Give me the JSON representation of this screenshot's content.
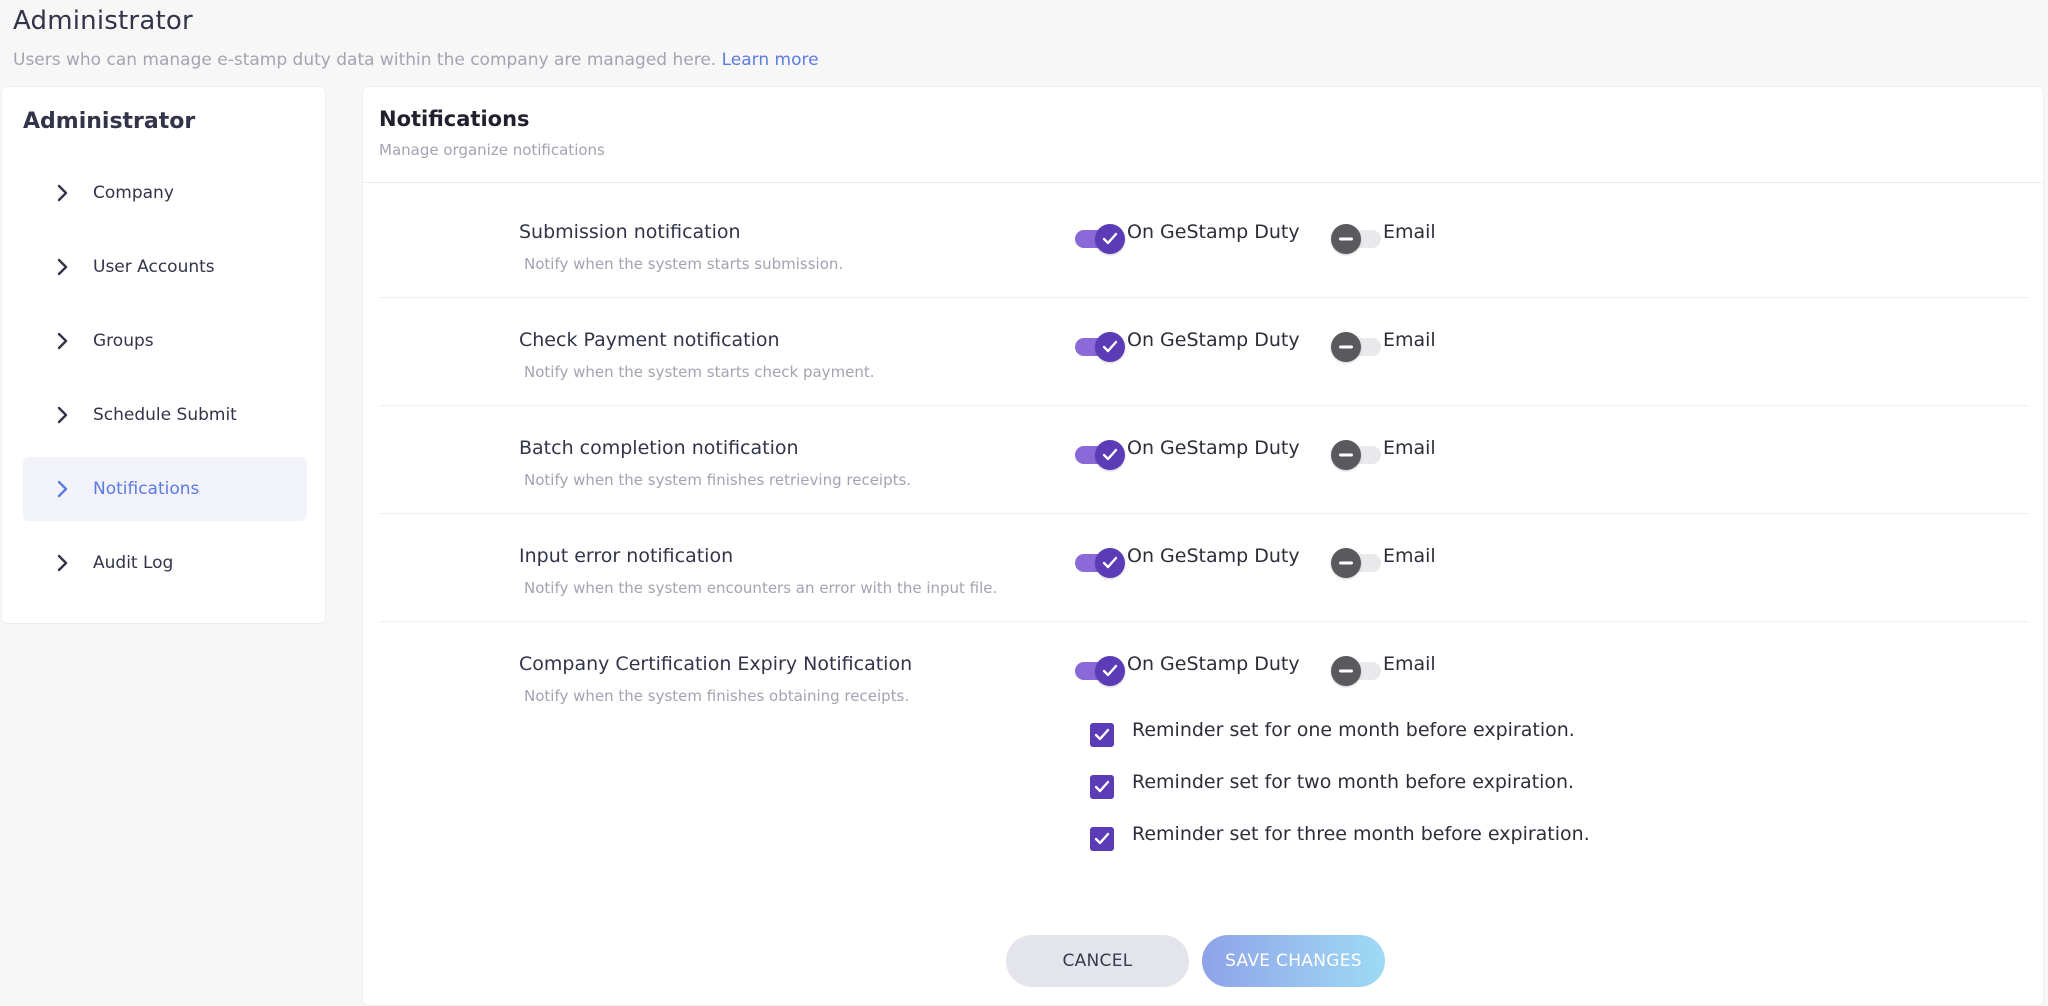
{
  "header": {
    "title": "Administrator",
    "subtitle": "Users who can manage e-stamp duty data within the company are managed here.",
    "learn_more": "Learn more"
  },
  "sidebar": {
    "title": "Administrator",
    "items": [
      {
        "label": "Company",
        "icon": "chevron-right-icon",
        "active": false
      },
      {
        "label": "User Accounts",
        "icon": "chevron-right-icon",
        "active": false
      },
      {
        "label": "Groups",
        "icon": "chevron-right-icon",
        "active": false
      },
      {
        "label": "Schedule Submit",
        "icon": "chevron-right-icon",
        "active": false
      },
      {
        "label": "Notifications",
        "icon": "chevron-right-icon",
        "active": true
      },
      {
        "label": "Audit Log",
        "icon": "chevron-right-icon",
        "active": false
      }
    ]
  },
  "main": {
    "title": "Notifications",
    "subtitle": "Manage organize notifications",
    "toggle_labels": {
      "system": "On GeStamp Duty",
      "email": "Email"
    },
    "notifications": [
      {
        "title": "Submission notification",
        "description": "Notify when the system starts submission.",
        "system_on": true,
        "email_on": false
      },
      {
        "title": "Check Payment notification",
        "description": "Notify when the system starts check payment.",
        "system_on": true,
        "email_on": false
      },
      {
        "title": "Batch completion notification",
        "description": "Notify when the system finishes retrieving receipts.",
        "system_on": true,
        "email_on": false
      },
      {
        "title": "Input error notification",
        "description": "Notify when the system encounters an error with the input file.",
        "system_on": true,
        "email_on": false
      },
      {
        "title": "Company Certification Expiry Notification",
        "description": "Notify when the system finishes obtaining receipts.",
        "system_on": true,
        "email_on": false
      }
    ],
    "reminders": [
      {
        "label": "Reminder set for one month before expiration.",
        "checked": true
      },
      {
        "label": "Reminder set for two month before expiration.",
        "checked": true
      },
      {
        "label": "Reminder set for three month before expiration.",
        "checked": true
      }
    ],
    "buttons": {
      "cancel": "CANCEL",
      "save": "SAVE CHANGES"
    }
  },
  "colors": {
    "accent": "#5b3bb6",
    "toggle_track_on": "#8a6ad8",
    "link": "#5c7be0",
    "muted_text": "#a3a3b3"
  }
}
